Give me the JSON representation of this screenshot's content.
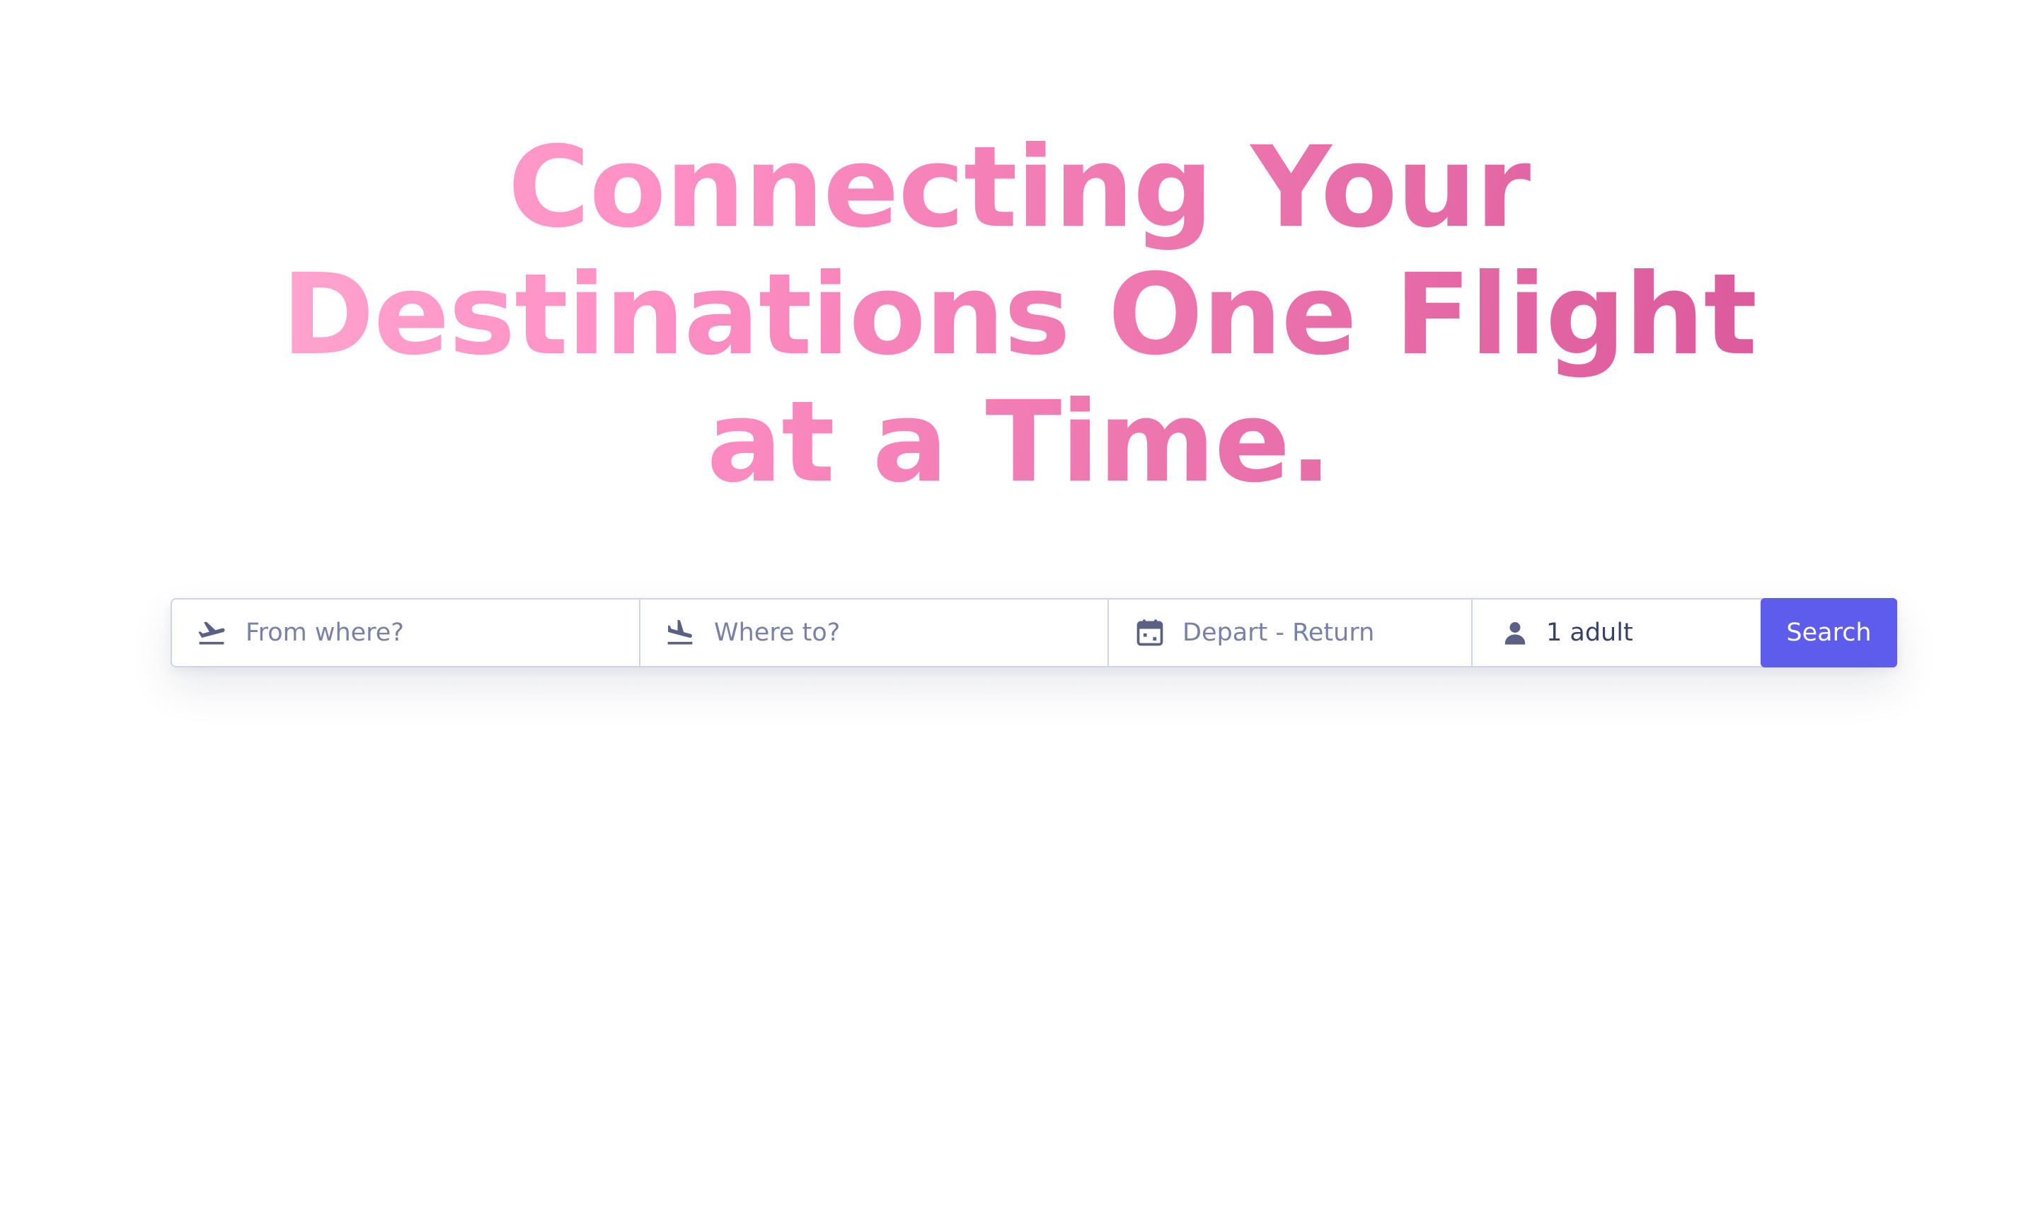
{
  "hero": {
    "title_lines": [
      "Connecting Your",
      "Destinations One Flight",
      "at a Time."
    ]
  },
  "search": {
    "from_placeholder": "From where?",
    "to_placeholder": "Where to?",
    "dates_placeholder": "Depart - Return",
    "travellers_value": "1 adult",
    "button_label": "Search"
  },
  "icons": {
    "from": "plane-takeoff-icon",
    "to": "plane-landing-icon",
    "dates": "calendar-icon",
    "travellers": "person-icon"
  },
  "colors": {
    "accent": "#5e5ced",
    "title_gradient_start": "#ffb3d6",
    "title_gradient_end": "#d6509a",
    "icon": "#5b6185",
    "placeholder": "#7a81a8",
    "border": "#cfd4ee"
  }
}
